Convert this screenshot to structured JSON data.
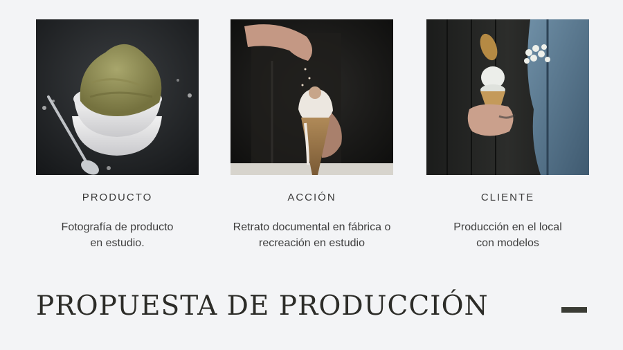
{
  "cards": [
    {
      "title": "PRODUCTO",
      "description": "Fotografía de producto\nen estudio.",
      "image": "matcha-ice-cream-bowl-photo"
    },
    {
      "title": "ACCIÓN",
      "description": "Retrato documental en fábrica o\nrecreación en estudio",
      "image": "ice-cream-cone-sprinkles-photo"
    },
    {
      "title": "CLIENTE",
      "description": "Producción en el local\ncon modelos",
      "image": "customer-holding-ice-cream-photo"
    }
  ],
  "headline": "PROPUESTA DE PRODUCCIÓN",
  "colors": {
    "background": "#f3f4f6",
    "text": "#3b3b3b",
    "headline": "#2c2c28",
    "accent_dash": "#3a3c35"
  }
}
